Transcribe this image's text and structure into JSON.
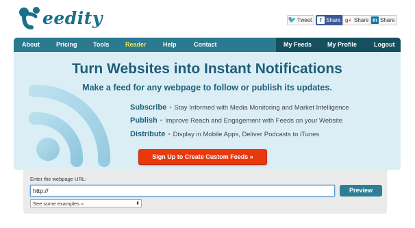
{
  "brand": {
    "logo_text": "eedity",
    "logo_initial": "F"
  },
  "share": {
    "twitter": {
      "icon": "twitter-icon",
      "label": "Tweet"
    },
    "facebook": {
      "icon": "facebook-icon",
      "label": "Share"
    },
    "gplus": {
      "icon": "google-plus-icon",
      "icon_text": "g+",
      "label": "Share"
    },
    "linkedin": {
      "icon": "linkedin-icon",
      "icon_text": "in",
      "label": "Share"
    }
  },
  "nav": {
    "left": [
      "About",
      "Pricing",
      "Tools",
      "Reader",
      "Help",
      "Contact"
    ],
    "active": "Reader",
    "right": [
      "My Feeds",
      "My Profile",
      "Logout"
    ]
  },
  "hero": {
    "title": "Turn Websites into Instant Notifications",
    "subtitle": "Make a feed for any webpage to follow or publish its updates.",
    "features": [
      {
        "name": "Subscribe",
        "desc": "Stay Informed with Media Monitoring and Market Intelligence"
      },
      {
        "name": "Publish",
        "desc": "Improve Reach and Engagement with Feeds on your Website"
      },
      {
        "name": "Distribute",
        "desc": "Display in Mobile Apps, Deliver Podcasts to iTunes"
      }
    ],
    "separator": "•",
    "cta": "Sign Up to Create Custom Feeds »"
  },
  "form": {
    "label": "Enter the webpage URL:",
    "url_value": "http://",
    "preview": "Preview",
    "examples_selected": "See some examples »"
  },
  "colors": {
    "nav": "#2b7a8f",
    "nav_right": "#16505f",
    "active_link": "#f4e45a",
    "hero_bg": "#dbeef6",
    "title": "#1f5e79",
    "cta": "#e8380d"
  }
}
